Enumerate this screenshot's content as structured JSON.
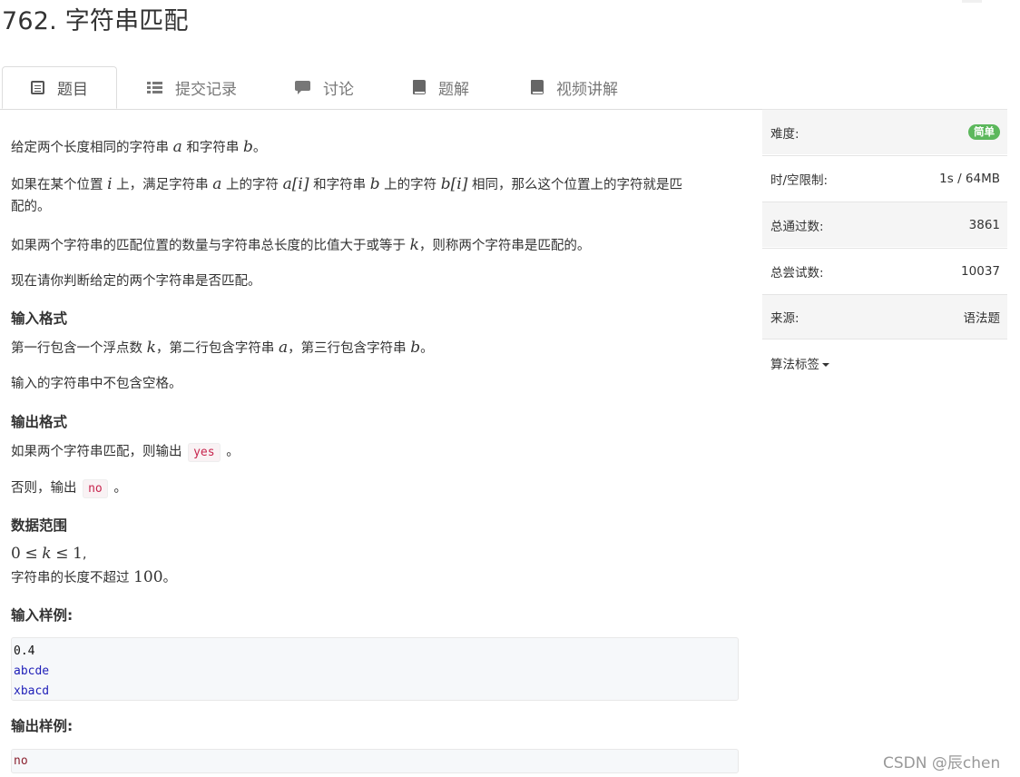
{
  "page": {
    "title": "762. 字符串匹配"
  },
  "tabs": [
    {
      "label": "题目",
      "icon": "list-alt-icon",
      "active": true
    },
    {
      "label": "提交记录",
      "icon": "list-icon",
      "active": false
    },
    {
      "label": "讨论",
      "icon": "comment-icon",
      "active": false
    },
    {
      "label": "题解",
      "icon": "book-icon",
      "active": false
    },
    {
      "label": "视频讲解",
      "icon": "book-icon",
      "active": false
    }
  ],
  "problem": {
    "p1": {
      "t1": "给定两个长度相同的字符串 ",
      "m1": "a",
      "t2": " 和字符串 ",
      "m2": "b",
      "t3": "。"
    },
    "p2": {
      "t1": "如果在某个位置 ",
      "m1": "i",
      "t2": " 上，满足字符串 ",
      "m2": "a",
      "t3": " 上的字符 ",
      "m3": "a[i]",
      "t4": " 和字符串 ",
      "m4": "b",
      "t5": " 上的字符 ",
      "m5": "b[i]",
      "t6": " 相同，那么这个位置上的字符就是匹",
      "t7": "配的。"
    },
    "p3": {
      "t1": "如果两个字符串的匹配位置的数量与字符串总长度的比值大于或等于 ",
      "m1": "k",
      "t2": "，则称两个字符串是匹配的。"
    },
    "p4": "现在请你判断给定的两个字符串是否匹配。",
    "input_heading": "输入格式",
    "input_p1": {
      "t1": "第一行包含一个浮点数 ",
      "m1": "k",
      "t2": "，第二行包含字符串 ",
      "m2": "a",
      "t3": "，第三行包含字符串 ",
      "m3": "b",
      "t4": "。"
    },
    "input_p2": "输入的字符串中不包含空格。",
    "output_heading": "输出格式",
    "output_p1": {
      "t1": "如果两个字符串匹配，则输出 ",
      "code": "yes",
      "t2": " 。"
    },
    "output_p2": {
      "t1": "否则，输出 ",
      "code": "no",
      "t2": " 。"
    },
    "range_heading": "数据范围",
    "range_p1": {
      "m1": "0",
      "op1": "≤",
      "m2": "k",
      "op2": "≤",
      "m3": "1",
      "t1": ","
    },
    "range_p2": {
      "t1": "字符串的长度不超过 ",
      "m1": "100",
      "t2": "。"
    },
    "sample_input_heading": "输入样例:",
    "sample_input": [
      "0.4",
      "abcde",
      "xbacd"
    ],
    "sample_output_heading": "输出样例:",
    "sample_output": [
      "no"
    ]
  },
  "sidebar": {
    "difficulty_label": "难度:",
    "difficulty_value": "简单",
    "limit_label": "时/空限制:",
    "limit_value": "1s / 64MB",
    "accepted_label": "总通过数:",
    "accepted_value": "3861",
    "attempts_label": "总尝试数:",
    "attempts_value": "10037",
    "source_label": "来源:",
    "source_value": "语法题",
    "tags_label": "算法标签"
  },
  "watermark": "CSDN @辰chen",
  "colors": {
    "badge": "#5cb85c",
    "code_inline": "#c7254e",
    "code_string": "#1f1fb8",
    "code_keyword": "#8b2230"
  }
}
